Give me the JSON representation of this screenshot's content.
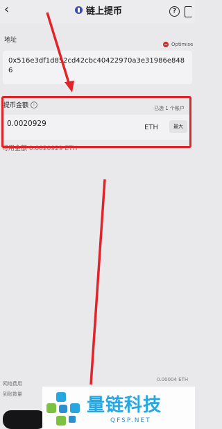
{
  "header": {
    "title": "链上提币",
    "back_icon": "back-arrow-icon",
    "help_glyph": "?"
  },
  "address": {
    "label": "地址",
    "optimise_label": "Optimise",
    "value": "0x516e3df1d852cd42cbc40422970a3e31986e8486"
  },
  "amount": {
    "label": "提币金额",
    "selected_text": "已选 1 个账户",
    "value": "0.0020929",
    "unit": "ETH",
    "max_label": "最大",
    "available": "可用金额 0.0020929 ETH"
  },
  "footer": {
    "fee_label": "网络费用",
    "receive_label": "到账数量",
    "fee_value": "0.00004 ETH"
  },
  "watermark": {
    "name": "量链科技",
    "url": "QFSP.NET"
  },
  "colors": {
    "highlight": "#e0242a",
    "brand": "#28a6e0",
    "eth": "#3b4bb0"
  }
}
